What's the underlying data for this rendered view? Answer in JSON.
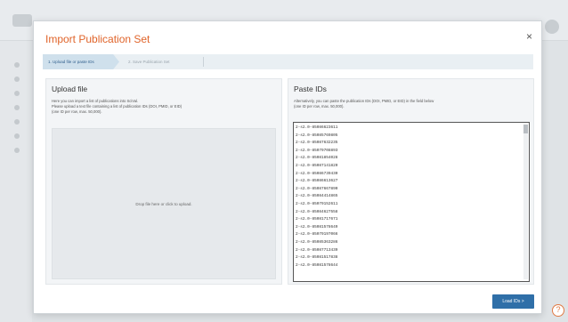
{
  "background": {
    "help_icon_label": "?"
  },
  "modal": {
    "title": "Import Publication Set",
    "close_label": "×",
    "steps": [
      {
        "label": "1. Upload file or paste IDs",
        "active": true
      },
      {
        "label": "2. Save Publication Set",
        "active": false
      }
    ],
    "upload": {
      "title": "Upload file",
      "desc_1": "Here you can import a list of publications into SciVal.",
      "desc_2": "Please upload a text file containing a list of publication IDs (DOI, PMID, or EID)",
      "desc_3": "(one ID per row, max. 50,000).",
      "dropzone_text": "Drop file here or click to upload."
    },
    "paste": {
      "title": "Paste IDs",
      "desc_1": "Alternatively, you can paste the publication IDs (DOI, PMID, or EID) in the field below",
      "desc_2": "(one ID per row, max. 50,000).",
      "ids": [
        "2-s2.0-85086623611",
        "2-s2.0-85085769805",
        "2-s2.0-85087632235",
        "2-s2.0-85079708893",
        "2-s2.0-85081854028",
        "2-s2.0-85087141820",
        "2-s2.0-85086739430",
        "2-s2.0-85086613627",
        "2-s2.0-85087667890",
        "2-s2.0-85084414865",
        "2-s2.0-85079152611",
        "2-s2.0-85084627558",
        "2-s2.0-85081717671",
        "2-s2.0-85081578649",
        "2-s2.0-85079197066",
        "2-s2.0-85085363286",
        "2-s2.0-85087713439",
        "2-s2.0-85081517838",
        "2-s2.0-85081578644"
      ]
    },
    "load_button": "Load IDs  >"
  },
  "colors": {
    "title": "#e0642a",
    "primary_button": "#2f6fa8",
    "active_step": "#cfe0ec"
  }
}
